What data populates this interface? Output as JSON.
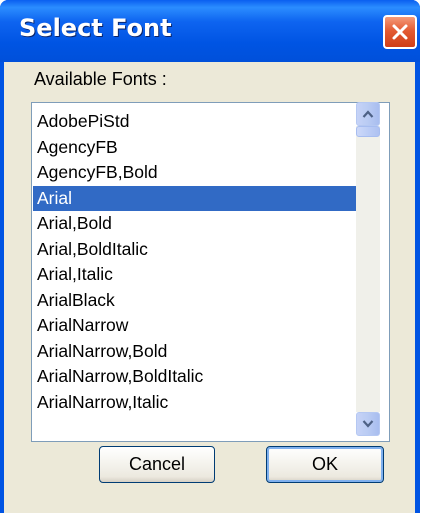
{
  "window": {
    "title": "Select Font"
  },
  "dialog": {
    "group_label": "Available Fonts :",
    "fonts": [
      "AdobePiStd",
      "AgencyFB",
      "AgencyFB,Bold",
      "Arial",
      "Arial,Bold",
      "Arial,BoldItalic",
      "Arial,Italic",
      "ArialBlack",
      "ArialNarrow",
      "ArialNarrow,Bold",
      "ArialNarrow,BoldItalic",
      "ArialNarrow,Italic"
    ],
    "selected_font": "Arial",
    "cancel_label": "Cancel",
    "ok_label": "OK"
  },
  "icons": {
    "close": "close-icon",
    "scroll_up": "chevron-up-icon",
    "scroll_down": "chevron-down-icon"
  },
  "colors": {
    "titlebar": "#0054e3",
    "selection": "#316ac5",
    "close_button": "#e35b33",
    "dialog_face": "#ece9d8"
  }
}
